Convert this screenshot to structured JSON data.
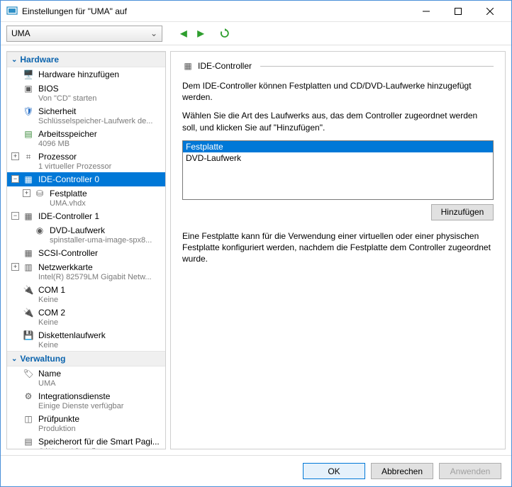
{
  "window": {
    "title": "Einstellungen für \"UMA\" auf "
  },
  "vm_selector": {
    "value": "UMA"
  },
  "sections": {
    "hardware": "Hardware",
    "management": "Verwaltung"
  },
  "tree": {
    "add_hw": "Hardware hinzufügen",
    "bios": {
      "label": "BIOS",
      "sub": "Von \"CD\" starten"
    },
    "security": {
      "label": "Sicherheit",
      "sub": "Schlüsselspeicher-Laufwerk de..."
    },
    "memory": {
      "label": "Arbeitsspeicher",
      "sub": "4096 MB"
    },
    "cpu": {
      "label": "Prozessor",
      "sub": "1 virtueller Prozessor"
    },
    "ide0": {
      "label": "IDE-Controller 0"
    },
    "ide0_disk": {
      "label": "Festplatte",
      "sub": "UMA.vhdx"
    },
    "ide1": {
      "label": "IDE-Controller 1"
    },
    "ide1_dvd": {
      "label": "DVD-Laufwerk",
      "sub": "spinstaller-uma-image-spx8..."
    },
    "scsi": {
      "label": "SCSI-Controller"
    },
    "nic": {
      "label": "Netzwerkkarte",
      "sub": "Intel(R) 82579LM Gigabit Netw..."
    },
    "com1": {
      "label": "COM 1",
      "sub": "Keine"
    },
    "com2": {
      "label": "COM 2",
      "sub": "Keine"
    },
    "floppy": {
      "label": "Diskettenlaufwerk",
      "sub": "Keine"
    },
    "name": {
      "label": "Name",
      "sub": "UMA"
    },
    "integ": {
      "label": "Integrationsdienste",
      "sub": "Einige Dienste verfügbar"
    },
    "checkpoints": {
      "label": "Prüfpunkte",
      "sub": "Produktion"
    },
    "smartpaging": {
      "label": "Speicherort für die Smart Pagi...",
      "sub": "C:\\Hyper-V\\configs"
    }
  },
  "panel": {
    "title": "IDE-Controller",
    "desc1": "Dem IDE-Controller können Festplatten und CD/DVD-Laufwerke hinzugefügt werden.",
    "desc2": "Wählen Sie die Art des Laufwerks aus, das dem Controller zugeordnet werden soll, und klicken Sie auf \"Hinzufügen\".",
    "options": [
      "Festplatte",
      "DVD-Laufwerk"
    ],
    "add_btn": "Hinzufügen",
    "note": "Eine Festplatte kann für die Verwendung einer virtuellen oder einer physischen Festplatte konfiguriert werden, nachdem die Festplatte dem Controller zugeordnet wurde."
  },
  "footer": {
    "ok": "OK",
    "cancel": "Abbrechen",
    "apply": "Anwenden"
  }
}
